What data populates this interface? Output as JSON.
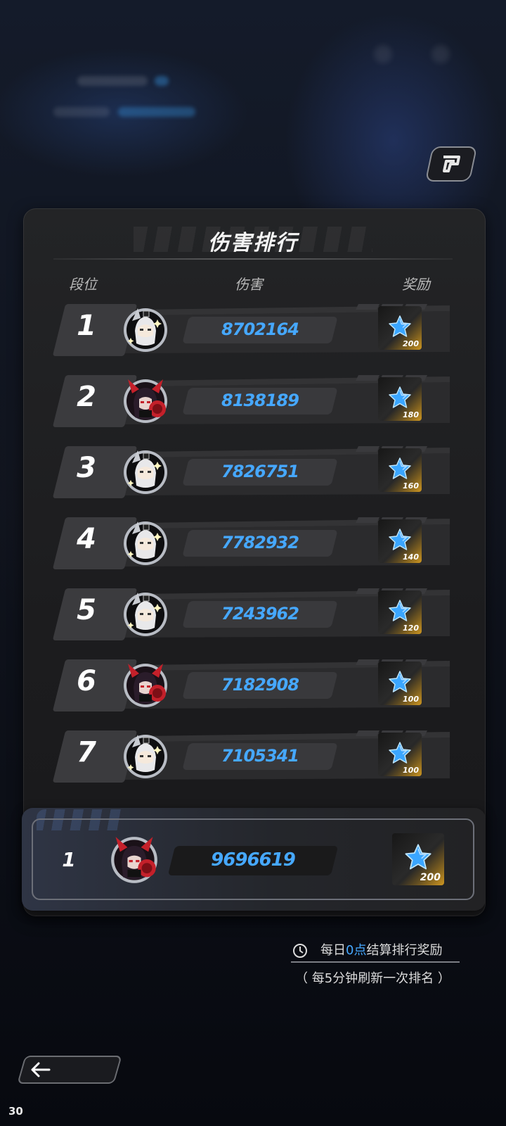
{
  "panel": {
    "title": "伤害排行",
    "headers": {
      "rank": "段位",
      "damage": "伤害",
      "reward": "奖励"
    }
  },
  "rankings": [
    {
      "rank": "1",
      "avatar": "white-hair-character-avatar",
      "damage": "8702164",
      "reward_count": "200"
    },
    {
      "rank": "2",
      "avatar": "red-black-character-avatar",
      "damage": "8138189",
      "reward_count": "180"
    },
    {
      "rank": "3",
      "avatar": "white-hair-character-avatar",
      "damage": "7826751",
      "reward_count": "160"
    },
    {
      "rank": "4",
      "avatar": "white-hair-character-avatar",
      "damage": "7782932",
      "reward_count": "140"
    },
    {
      "rank": "5",
      "avatar": "white-hair-character-avatar",
      "damage": "7243962",
      "reward_count": "120"
    },
    {
      "rank": "6",
      "avatar": "red-black-character-avatar",
      "damage": "7182908",
      "reward_count": "100"
    },
    {
      "rank": "7",
      "avatar": "white-hair-character-avatar",
      "damage": "7105341",
      "reward_count": "100"
    }
  ],
  "my_entry": {
    "rank": "1",
    "avatar": "red-black-character-avatar",
    "damage": "9696619",
    "reward_count": "200"
  },
  "footer": {
    "settle_prefix": "每日",
    "settle_highlight": "0点",
    "settle_suffix": "结算排行奖励",
    "refresh_note": "（ 每5分钟刷新一次排名 ）"
  },
  "fps": "30",
  "icons": {
    "share": "share-icon",
    "reward": "blue-star-icon",
    "clock": "clock-icon",
    "back": "back-arrow-icon"
  },
  "colors": {
    "accent_blue": "#46a8ff",
    "reward_gold": "#e2a523",
    "avatar_red": "#c4202a"
  }
}
